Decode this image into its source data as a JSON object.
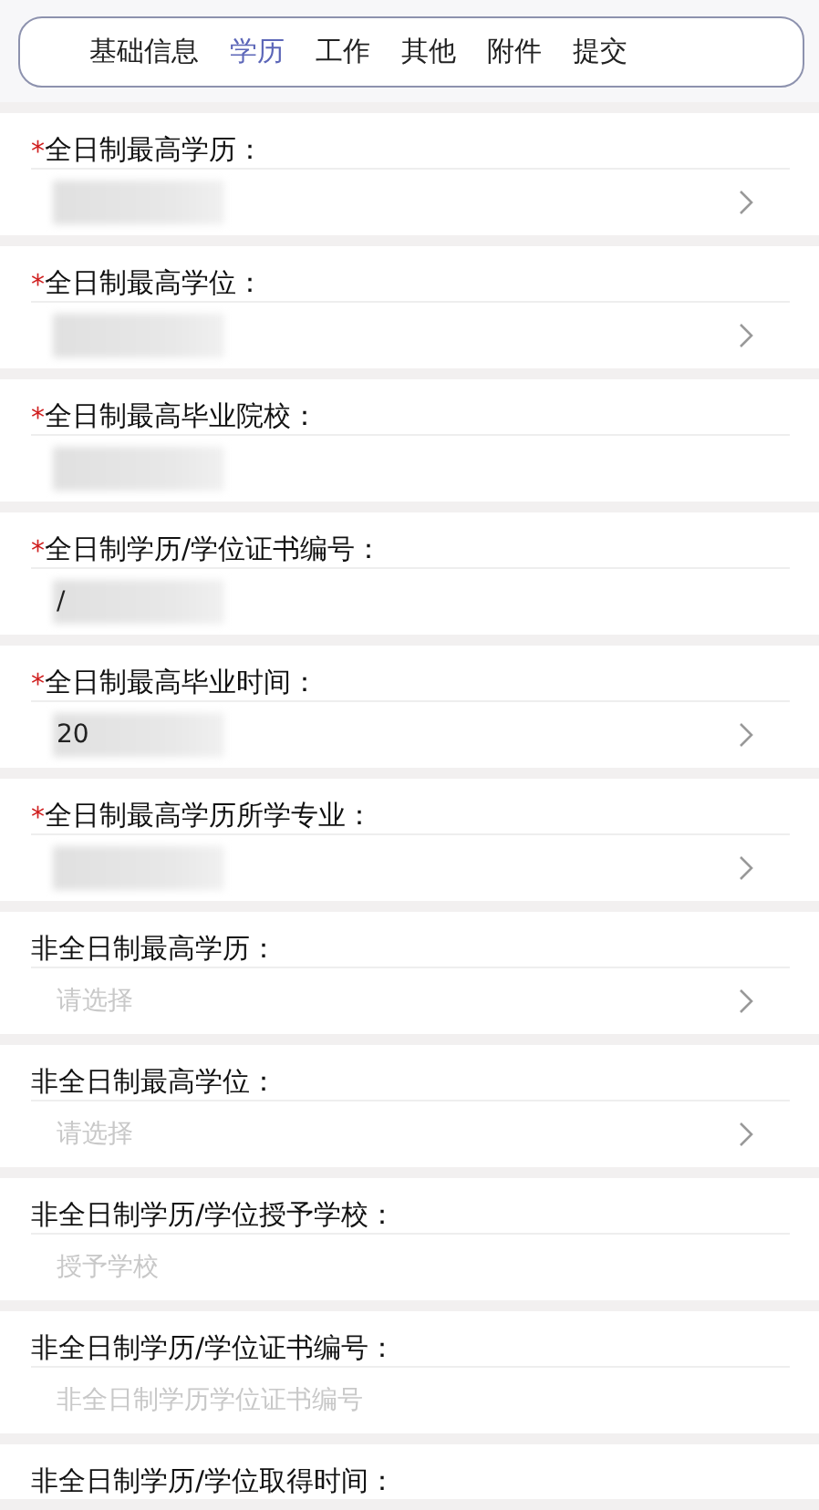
{
  "tabs": [
    {
      "label": "基础信息",
      "selected": false
    },
    {
      "label": "学历",
      "selected": true
    },
    {
      "label": "工作",
      "selected": false
    },
    {
      "label": "其他",
      "selected": false
    },
    {
      "label": "附件",
      "selected": false
    },
    {
      "label": "提交",
      "selected": false
    }
  ],
  "fields": [
    {
      "label": "全日制最高学历：",
      "marker": "*",
      "kind": "select",
      "masked": true
    },
    {
      "label": "全日制最高学位：",
      "marker": "*",
      "kind": "select",
      "masked": true
    },
    {
      "label": "全日制最高毕业院校：",
      "marker": "*",
      "kind": "text",
      "masked": true
    },
    {
      "label": "全日制学历/学位证书编号：",
      "marker": "*",
      "kind": "text",
      "masked": true,
      "value": "/"
    },
    {
      "label": "全日制最高毕业时间：",
      "marker": "*",
      "kind": "select",
      "masked": true,
      "value": "20"
    },
    {
      "label": "全日制最高学历所学专业：",
      "marker": "*",
      "kind": "select",
      "masked": true
    },
    {
      "label": "非全日制最高学历：",
      "kind": "select",
      "masked": false,
      "placeholder": "请选择"
    },
    {
      "label": "非全日制最高学位：",
      "kind": "select",
      "masked": false,
      "placeholder": "请选择"
    },
    {
      "label": "非全日制学历/学位授予学校：",
      "kind": "text",
      "masked": false,
      "placeholder": "授予学校"
    },
    {
      "label": "非全日制学历/学位证书编号：",
      "kind": "text",
      "masked": false,
      "placeholder": "非全日制学历学位证书编号"
    },
    {
      "label": "非全日制学历/学位取得时间：",
      "kind": "label-only"
    }
  ]
}
